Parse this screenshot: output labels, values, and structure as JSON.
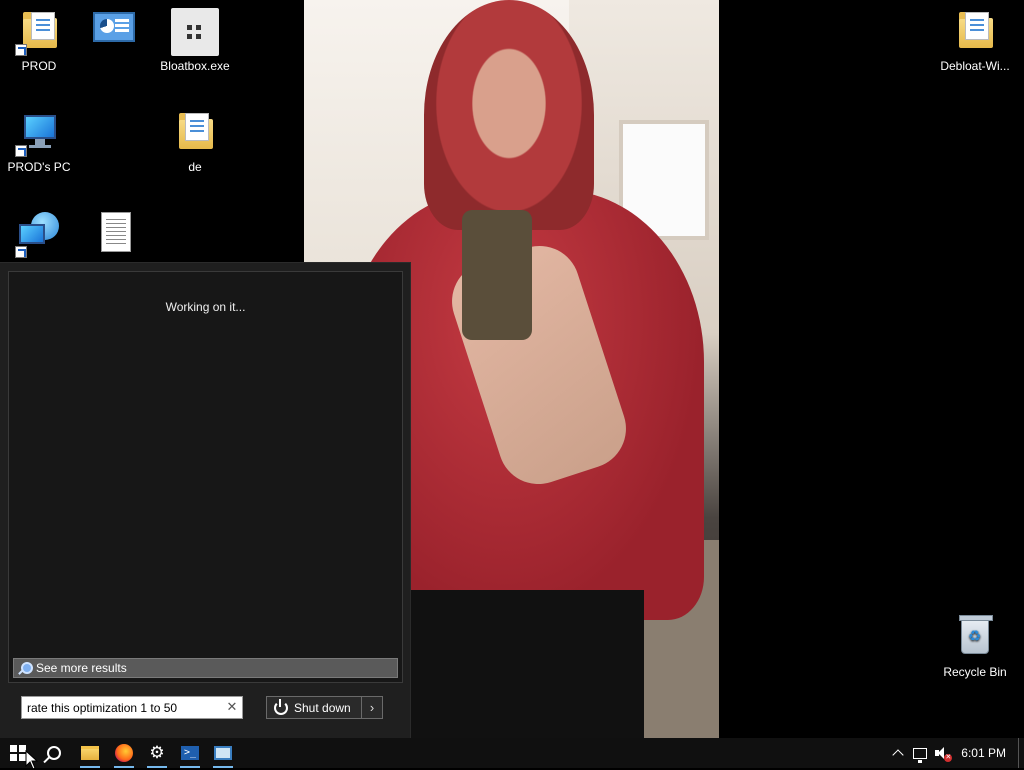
{
  "desktop": {
    "icons": {
      "prod": "PROD",
      "dashboard": "",
      "bloatbox": "Bloatbox.exe",
      "debloat": "Debloat-Wi...",
      "prods_pc": "PROD's PC",
      "de": "de",
      "network": "",
      "textfile": "",
      "recycle_bin": "Recycle Bin"
    }
  },
  "search_popup": {
    "status": "Working on it...",
    "see_more": "See more results",
    "query": "rate this optimization 1 to 50",
    "clear_glyph": "✕",
    "shutdown_label": "Shut down",
    "shutdown_arrow": "›"
  },
  "taskbar": {
    "items": [
      "start-icon",
      "search-icon",
      "file-explorer-icon",
      "firefox-icon",
      "settings-icon",
      "powershell-icon",
      "remote-desktop-icon"
    ],
    "powershell_glyph": ">_",
    "settings_glyph": "⚙",
    "clock": "6:01 PM",
    "tray": [
      "chevron-up-icon",
      "network-icon",
      "volume-muted-icon"
    ]
  }
}
